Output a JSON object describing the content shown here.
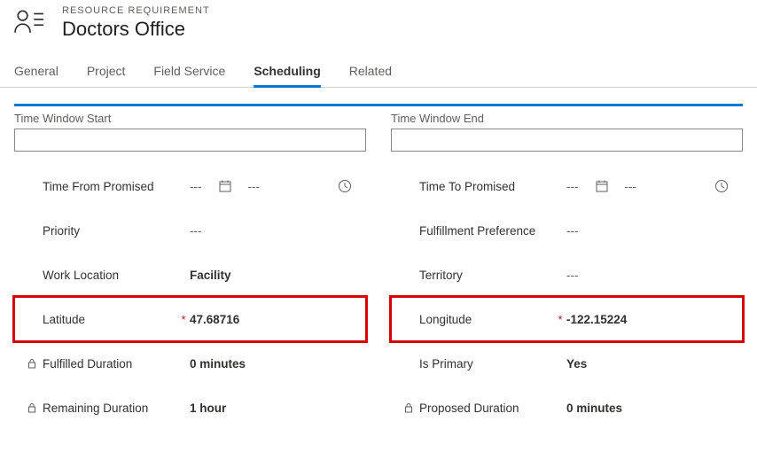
{
  "header": {
    "eyebrow": "RESOURCE REQUIREMENT",
    "title": "Doctors Office"
  },
  "tabs": {
    "general": "General",
    "project": "Project",
    "fieldService": "Field Service",
    "scheduling": "Scheduling",
    "related": "Related"
  },
  "sections": {
    "left": "Time Window Start",
    "right": "Time Window End"
  },
  "placeholders": {
    "dash": "---"
  },
  "left": {
    "timeFromPromised": {
      "label": "Time From Promised"
    },
    "priority": {
      "label": "Priority",
      "value": "---"
    },
    "workLocation": {
      "label": "Work Location",
      "value": "Facility"
    },
    "latitude": {
      "label": "Latitude",
      "value": "47.68716"
    },
    "fulfilledDuration": {
      "label": "Fulfilled Duration",
      "value": "0 minutes"
    },
    "remainingDuration": {
      "label": "Remaining Duration",
      "value": "1 hour"
    }
  },
  "right": {
    "timeToPromised": {
      "label": "Time To Promised"
    },
    "fulfillmentPreference": {
      "label": "Fulfillment Preference",
      "value": "---"
    },
    "territory": {
      "label": "Territory",
      "value": "---"
    },
    "longitude": {
      "label": "Longitude",
      "value": "-122.15224"
    },
    "isPrimary": {
      "label": "Is Primary",
      "value": "Yes"
    },
    "proposedDuration": {
      "label": "Proposed Duration",
      "value": "0 minutes"
    }
  }
}
